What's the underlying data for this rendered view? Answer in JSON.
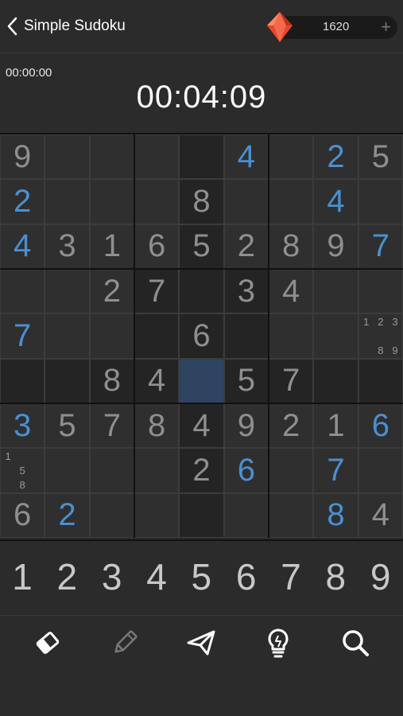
{
  "header": {
    "title": "Simple Sudoku",
    "coins": "1620",
    "plus_label": "+",
    "accent_color": "#4b8fd1",
    "gem_color": "#e8452c"
  },
  "timer": {
    "best_time": "00:00:00",
    "h": "00",
    "m": "04",
    "s": "09",
    "sep": ":"
  },
  "board": {
    "rows": [
      [
        "9",
        "",
        "",
        "",
        "",
        "4",
        "",
        "2",
        "5"
      ],
      [
        "2",
        "",
        "",
        "",
        "8",
        "",
        "",
        "4",
        ""
      ],
      [
        "4",
        "3",
        "1",
        "6",
        "5",
        "2",
        "8",
        "9",
        "7"
      ],
      [
        "",
        "",
        "2",
        "7",
        "",
        "3",
        "4",
        "",
        ""
      ],
      [
        "7",
        "",
        "",
        "",
        "6",
        "",
        "",
        "",
        ""
      ],
      [
        "",
        "",
        "8",
        "4",
        "",
        "5",
        "7",
        "",
        ""
      ],
      [
        "3",
        "5",
        "7",
        "8",
        "4",
        "9",
        "2",
        "1",
        "6"
      ],
      [
        "",
        "",
        "",
        "",
        "2",
        "6",
        "",
        "7",
        ""
      ],
      [
        "6",
        "2",
        "",
        "",
        "",
        "",
        "",
        "8",
        "4"
      ]
    ],
    "user_cells": [
      [
        0,
        5
      ],
      [
        0,
        7
      ],
      [
        1,
        0
      ],
      [
        1,
        7
      ],
      [
        2,
        0
      ],
      [
        2,
        8
      ],
      [
        4,
        0
      ],
      [
        6,
        0
      ],
      [
        6,
        8
      ],
      [
        7,
        5
      ],
      [
        7,
        7
      ],
      [
        8,
        1
      ],
      [
        8,
        7
      ]
    ],
    "selected": [
      5,
      4
    ],
    "notes": [
      {
        "row": 4,
        "col": 8,
        "marks": [
          "1",
          "2",
          "3",
          "",
          "",
          "",
          "",
          "8",
          "9"
        ]
      },
      {
        "row": 7,
        "col": 0,
        "marks": [
          "1",
          "",
          "",
          "",
          "5",
          "",
          "",
          "8",
          ""
        ]
      }
    ]
  },
  "pad": {
    "numbers": [
      "1",
      "2",
      "3",
      "4",
      "5",
      "6",
      "7",
      "8",
      "9"
    ]
  },
  "toolbar": {
    "tools": [
      {
        "name": "eraser-icon"
      },
      {
        "name": "pencil-icon"
      },
      {
        "name": "send-icon"
      },
      {
        "name": "hint-bulb-icon"
      },
      {
        "name": "search-icon"
      }
    ]
  }
}
